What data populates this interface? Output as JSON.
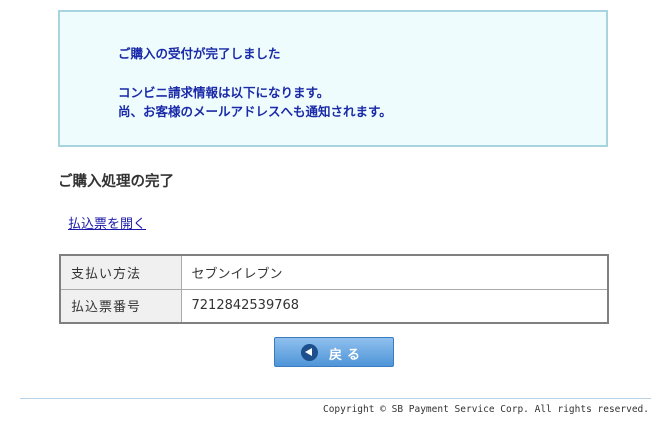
{
  "notice": {
    "line1": "ご購入の受付が完了しました",
    "line2": "コンビニ請求情報は以下になります。",
    "line3": "尚、お客様のメールアドレスへも通知されます。"
  },
  "section": {
    "title": "ご購入処理の完了"
  },
  "link": {
    "open_slip": "払込票を開く"
  },
  "payment_table": {
    "rows": [
      {
        "label": "支払い方法",
        "value": "セブンイレブン"
      },
      {
        "label": "払込票番号",
        "value": "7212842539768"
      }
    ]
  },
  "buttons": {
    "back_label": "戻る",
    "back_icon": "back-arrow-icon"
  },
  "footer": {
    "copyright": "Copyright © SB Payment Service Corp. All rights reserved."
  },
  "colors": {
    "notice_bg": "#eefcfd",
    "notice_border": "#a8d4e0",
    "notice_text": "#1a2aa8",
    "button": "#4f95d8"
  }
}
